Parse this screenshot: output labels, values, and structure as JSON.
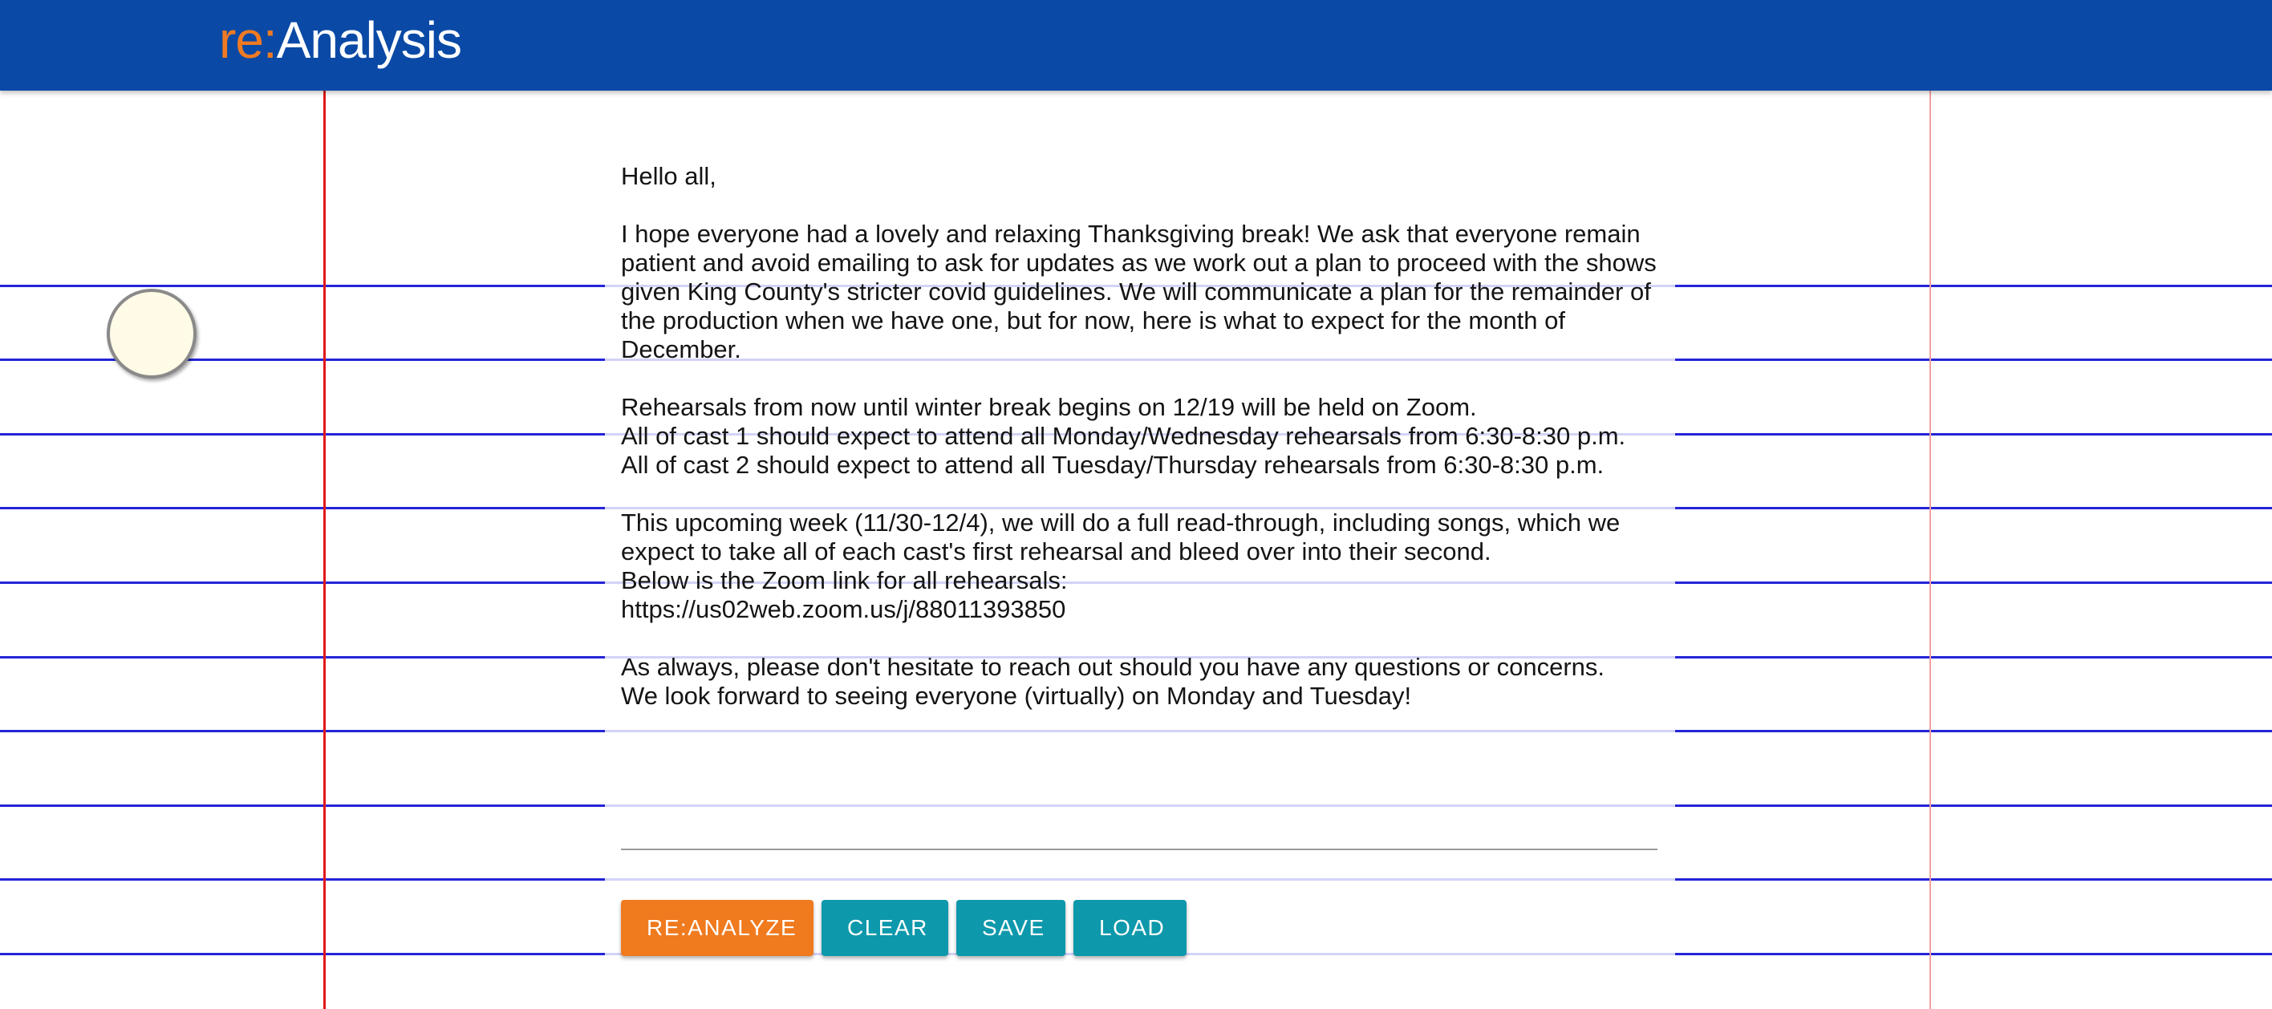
{
  "app": {
    "brand_prefix": "re:",
    "brand_rest": "Analysis"
  },
  "editor": {
    "text": "Hello all,\n\nI hope everyone had a lovely and relaxing Thanksgiving break! We ask that everyone remain patient and avoid emailing to ask for updates as we work out a plan to proceed with the shows given King County's stricter covid guidelines. We will communicate a plan for the remainder of the production when we have one, but for now, here is what to expect for the month of December.\n\nRehearsals from now until winter break begins on 12/19 will be held on Zoom.\nAll of cast 1 should expect to attend all Monday/Wednesday rehearsals from 6:30-8:30 p.m.\nAll of cast 2 should expect to attend all Tuesday/Thursday rehearsals from 6:30-8:30 p.m.\n\nThis upcoming week (11/30-12/4), we will do a full read-through, including songs, which we expect to take all of each cast's first rehearsal and bleed over into their second.\nBelow is the Zoom link for all rehearsals:\nhttps://us02web.zoom.us/j/88011393850\n\nAs always, please don't hesitate to reach out should you have any questions or concerns.\nWe look forward to seeing everyone (virtually) on Monday and Tuesday!"
  },
  "buttons": {
    "reanalyze": "RE:ANALYZE",
    "clear": "CLEAR",
    "save": "SAVE",
    "load": "LOAD"
  },
  "colors": {
    "header": "#0a4aa6",
    "brand_accent": "#f07a22",
    "primary_button": "#f07a1e",
    "secondary_button": "#0e98ab",
    "rule_line": "#2424d8",
    "margin_line": "#e01818"
  }
}
